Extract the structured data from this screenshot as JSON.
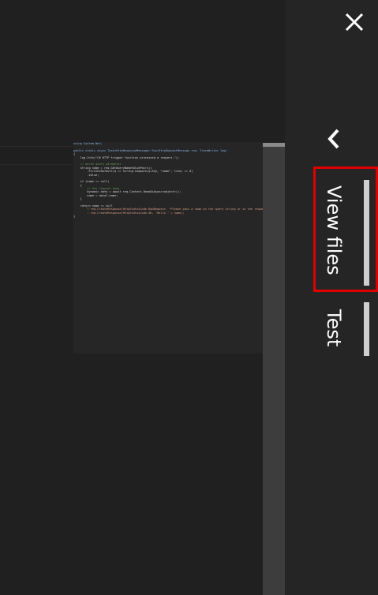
{
  "editor": {
    "code_lines": [
      {
        "text": "using System.Net;",
        "cls": "kw"
      },
      {
        "text": "",
        "cls": ""
      },
      {
        "text": "public static async Task<HttpResponseMessage> Run(HttpRequestMessage req, TraceWriter log)",
        "cls": "kw"
      },
      {
        "text": "{",
        "cls": ""
      },
      {
        "text": "    log.Info(\"C# HTTP trigger function processed a request.\");",
        "cls": ""
      },
      {
        "text": "",
        "cls": ""
      },
      {
        "text": "    // parse query parameter",
        "cls": "cm"
      },
      {
        "text": "    string name = req.GetQueryNameValuePairs()",
        "cls": ""
      },
      {
        "text": "        .FirstOrDefault(q => string.Compare(q.Key, \"name\", true) == 0)",
        "cls": ""
      },
      {
        "text": "        .Value;",
        "cls": ""
      },
      {
        "text": "",
        "cls": ""
      },
      {
        "text": "    if (name == null)",
        "cls": ""
      },
      {
        "text": "    {",
        "cls": ""
      },
      {
        "text": "        // Get request body",
        "cls": "cm"
      },
      {
        "text": "        dynamic data = await req.Content.ReadAsAsync<object>();",
        "cls": ""
      },
      {
        "text": "        name = data?.name;",
        "cls": ""
      },
      {
        "text": "    }",
        "cls": ""
      },
      {
        "text": "",
        "cls": ""
      },
      {
        "text": "    return name == null",
        "cls": ""
      },
      {
        "text": "        ? req.CreateResponse(HttpStatusCode.BadRequest, \"Please pass a name on the query string or in the request body\")",
        "cls": "str"
      },
      {
        "text": "        : req.CreateResponse(HttpStatusCode.OK, \"Hello \" + name);",
        "cls": "str"
      },
      {
        "text": "}",
        "cls": ""
      }
    ]
  },
  "panel": {
    "close_icon": "close-icon",
    "back_icon": "chevron-left-icon",
    "tabs": [
      {
        "label": "View files",
        "active": true
      },
      {
        "label": "Test",
        "active": false
      }
    ]
  },
  "colors": {
    "highlight": "#e00000",
    "panel_bg": "#252525",
    "indicator": "#cfcfcf"
  }
}
